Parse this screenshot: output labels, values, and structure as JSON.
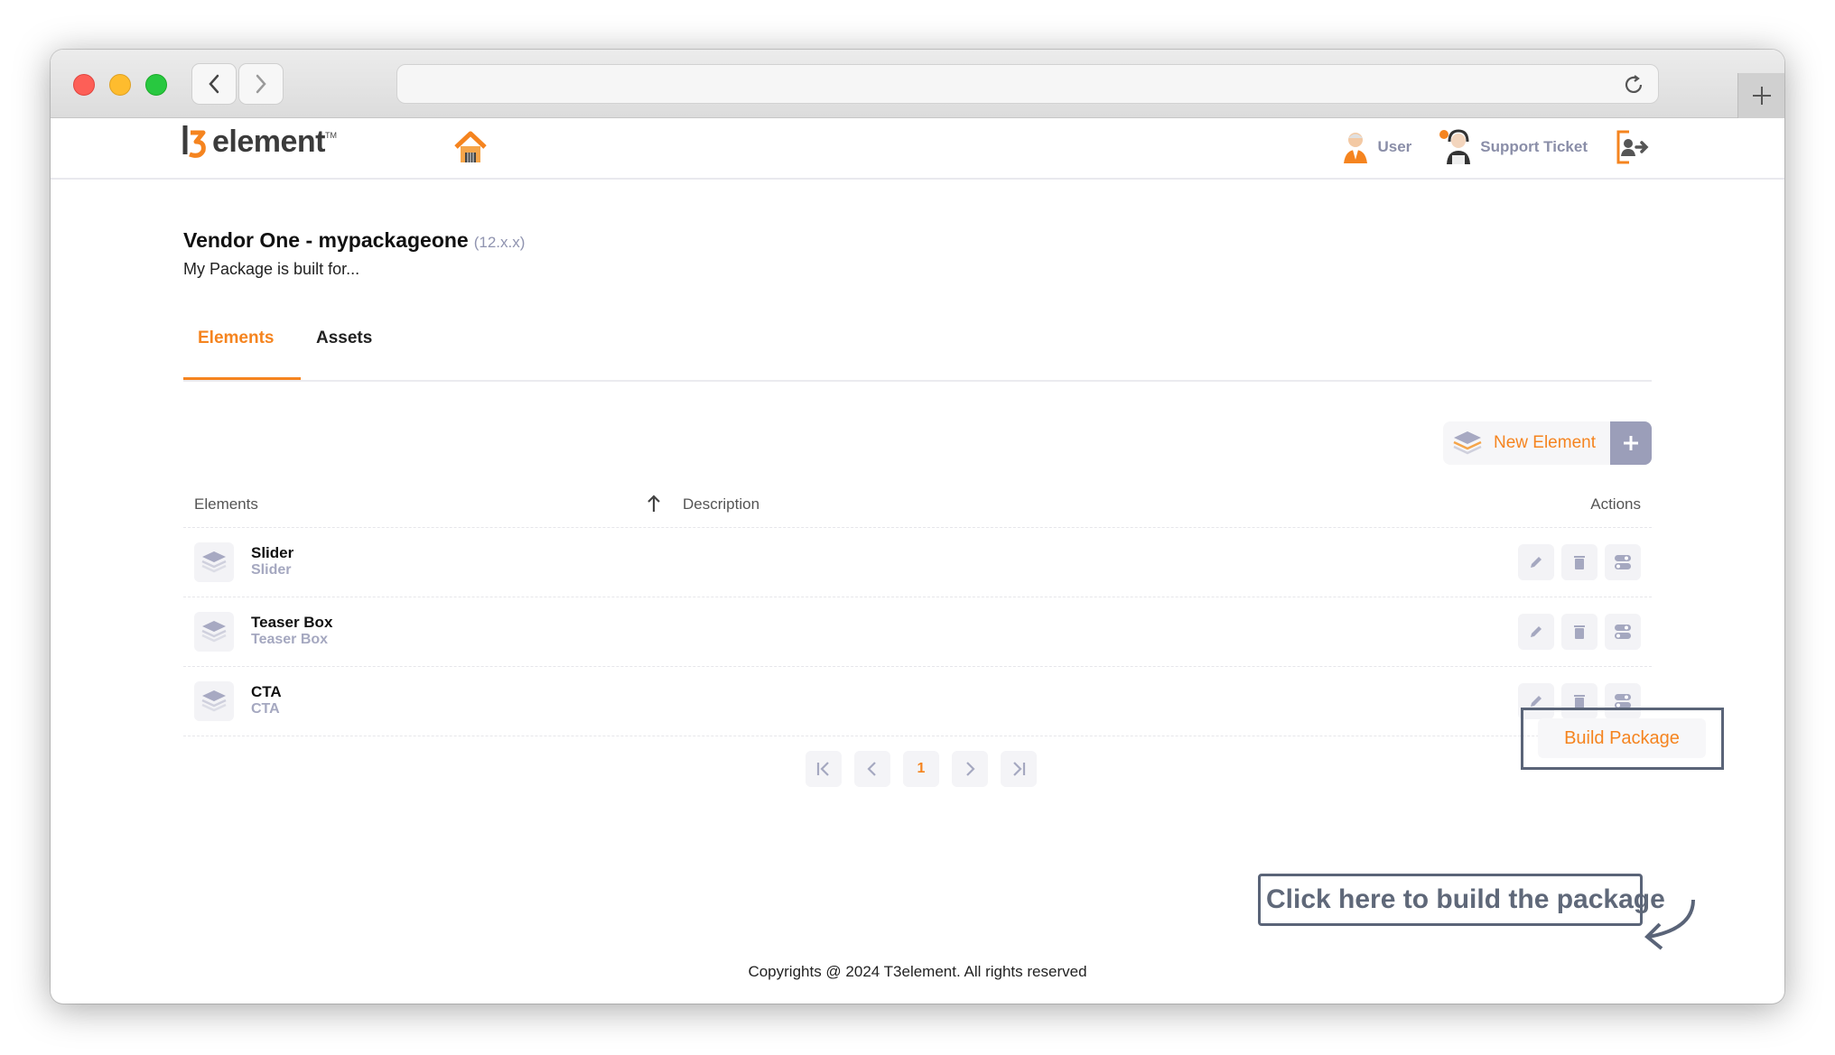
{
  "browser": {
    "url": ""
  },
  "header": {
    "logo_text": "element",
    "logo_tm": "TM",
    "user_label": "User",
    "support_label": "Support Ticket"
  },
  "package": {
    "title": "Vendor One - mypackageone",
    "version": "(12.x.x)",
    "description": "My Package is built for..."
  },
  "tabs": [
    {
      "label": "Elements"
    },
    {
      "label": "Assets"
    }
  ],
  "new_element_label": "New Element",
  "table": {
    "headers": {
      "elements": "Elements",
      "description": "Description",
      "actions": "Actions"
    },
    "rows": [
      {
        "name": "Slider",
        "sub": "Slider"
      },
      {
        "name": "Teaser Box",
        "sub": "Teaser Box"
      },
      {
        "name": "CTA",
        "sub": "CTA"
      }
    ]
  },
  "pagination": {
    "current": "1"
  },
  "build_label": "Build Package",
  "callout": "Click here to build the package",
  "footer": "Copyrights @ 2024 T3element. All rights reserved",
  "colors": {
    "accent": "#f5841f",
    "muted": "#9b9eb9"
  }
}
